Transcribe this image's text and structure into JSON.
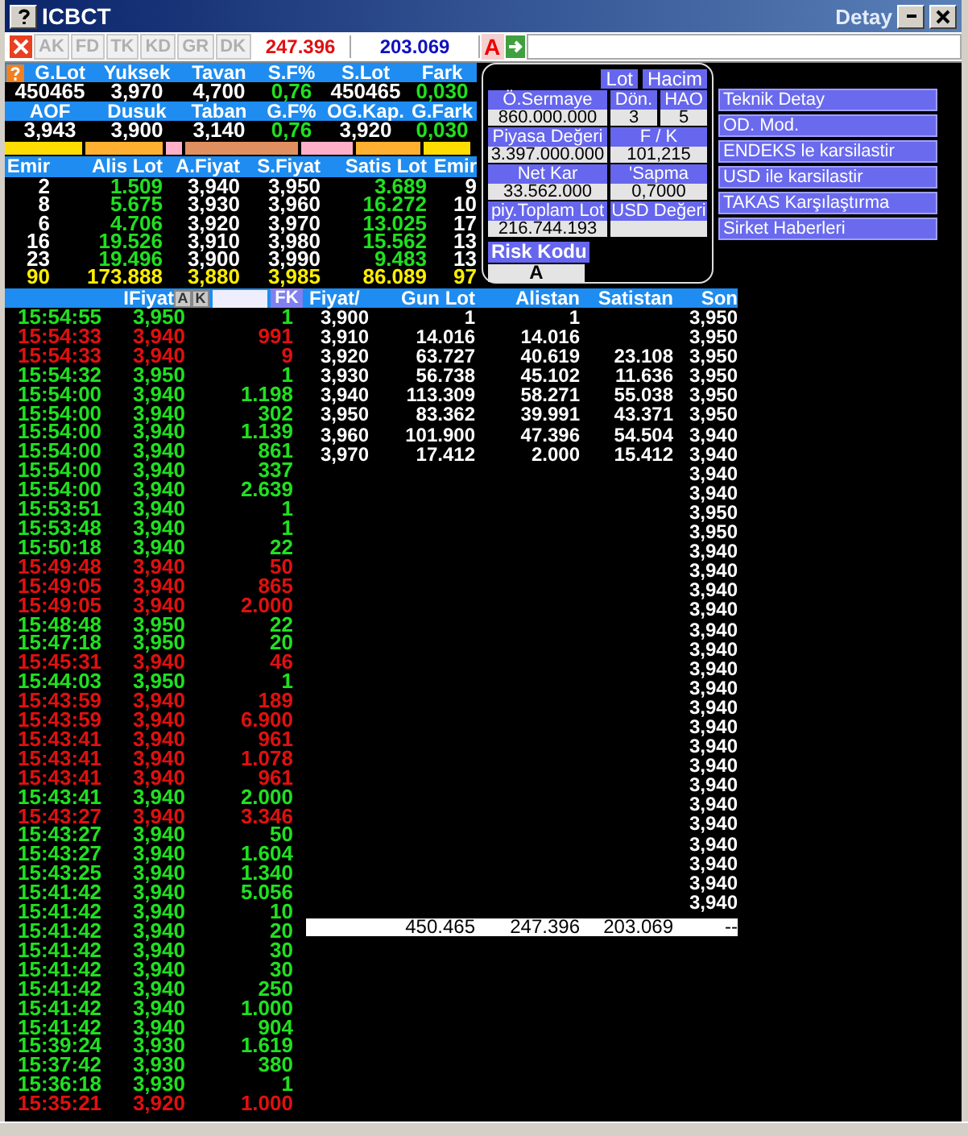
{
  "window": {
    "title": "ICBCT",
    "caption": "Detay"
  },
  "toolbar": {
    "buttons": [
      {
        "label": "AK",
        "disabled": true
      },
      {
        "label": "FD",
        "disabled": true
      },
      {
        "label": "TK",
        "disabled": true
      },
      {
        "label": "KD",
        "disabled": true
      },
      {
        "label": "GR",
        "disabled": true
      },
      {
        "label": "DK",
        "disabled": true
      }
    ],
    "sell_total": "247.396",
    "buy_total": "203.069",
    "mode": "A"
  },
  "stats": [
    {
      "headers": [
        "G.Lot",
        "Yuksek",
        "Tavan",
        "S.F%",
        "S.Lot",
        "Fark"
      ],
      "values": [
        {
          "text": "450465",
          "kind": "plain"
        },
        {
          "text": "3,970",
          "kind": "plain"
        },
        {
          "text": "4,700",
          "kind": "plain"
        },
        {
          "text": "0,76",
          "kind": "change"
        },
        {
          "text": "450465",
          "kind": "plain"
        },
        {
          "text": "0,030",
          "kind": "change"
        }
      ]
    },
    {
      "headers": [
        "AOF",
        "Dusuk",
        "Taban",
        "G.F%",
        "OG.Kap.",
        "G.Fark"
      ],
      "values": [
        {
          "text": "3,943",
          "kind": "plain"
        },
        {
          "text": "3,900",
          "kind": "plain"
        },
        {
          "text": "3,140",
          "kind": "plain"
        },
        {
          "text": "0,76",
          "kind": "change"
        },
        {
          "text": "3,920",
          "kind": "plain"
        },
        {
          "text": "0,030",
          "kind": "change"
        }
      ]
    }
  ],
  "depth": {
    "columns": [
      "Emir",
      "Alis Lot",
      "A.Fiyat",
      "S.Fiyat",
      "Satis Lot",
      "Emir"
    ],
    "rows": [
      {
        "cells": [
          "2",
          "1.509",
          "3,940",
          "3,950",
          "3.689",
          "9"
        ],
        "total": false
      },
      {
        "cells": [
          "8",
          "5.675",
          "3,930",
          "3,960",
          "16.272",
          "10"
        ],
        "total": false
      },
      {
        "cells": [
          "6",
          "4.706",
          "3,920",
          "3,970",
          "13.025",
          "17"
        ],
        "total": false
      },
      {
        "cells": [
          "16",
          "19.526",
          "3,910",
          "3,980",
          "15.562",
          "13"
        ],
        "total": false
      },
      {
        "cells": [
          "23",
          "19.496",
          "3,900",
          "3,990",
          "9.483",
          "13"
        ],
        "total": false
      },
      {
        "cells": [
          "90",
          "173.888",
          "3,880",
          "3,985",
          "86.089",
          "97"
        ],
        "total": true
      }
    ]
  },
  "info": {
    "toggles": [
      "Lot",
      "Hacim"
    ],
    "rows": [
      [
        {
          "label": "Ö.Sermaye",
          "value": "860.000.000"
        },
        {
          "label": "Dön.",
          "value": "3"
        },
        {
          "label": "HAO",
          "value": "5"
        }
      ],
      [
        {
          "label": "Piyasa Değeri",
          "value": "3.397.000.000"
        },
        {
          "label": "F / K",
          "value": "101,215"
        }
      ],
      [
        {
          "label": "Net Kar",
          "value": "33.562.000"
        },
        {
          "label": "'Sapma",
          "value": "0,7000"
        }
      ],
      [
        {
          "label": "piy.Toplam Lot",
          "value": "216.744.193"
        },
        {
          "label": "USD Değeri"
        }
      ]
    ],
    "risk": {
      "label": "Risk Kodu",
      "value": "A"
    }
  },
  "actions": [
    "Teknik Detay",
    "OD. Mod.",
    "ENDEKS le karsilastir",
    "USD ile karsilastir",
    "TAKAS Karşılaştırma",
    "Sirket Haberleri"
  ],
  "trades": {
    "header": "IFiyat",
    "buttons": [
      "A",
      "K"
    ],
    "filter_button": "FK",
    "rows": [
      {
        "time": "15:54:55",
        "price": "3,950",
        "lot": "1",
        "color": "#20e020"
      },
      {
        "time": "15:54:33",
        "price": "3,940",
        "lot": "991",
        "color": "#e01010"
      },
      {
        "time": "15:54:33",
        "price": "3,940",
        "lot": "9",
        "color": "#e01010"
      },
      {
        "time": "15:54:32",
        "price": "3,950",
        "lot": "1",
        "color": "#20e020"
      },
      {
        "time": "15:54:00",
        "price": "3,940",
        "lot": "1.198",
        "color": "#20e020"
      },
      {
        "time": "15:54:00",
        "price": "3,940",
        "lot": "302",
        "color": "#20e020"
      },
      {
        "time": "15:54:00",
        "price": "3,940",
        "lot": "1.139",
        "color": "#20e020"
      },
      {
        "time": "15:54:00",
        "price": "3,940",
        "lot": "861",
        "color": "#20e020"
      },
      {
        "time": "15:54:00",
        "price": "3,940",
        "lot": "337",
        "color": "#20e020"
      },
      {
        "time": "15:54:00",
        "price": "3,940",
        "lot": "2.639",
        "color": "#20e020"
      },
      {
        "time": "15:53:51",
        "price": "3,940",
        "lot": "1",
        "color": "#20e020"
      },
      {
        "time": "15:53:48",
        "price": "3,940",
        "lot": "1",
        "color": "#20e020"
      },
      {
        "time": "15:50:18",
        "price": "3,940",
        "lot": "22",
        "color": "#20e020"
      },
      {
        "time": "15:49:48",
        "price": "3,940",
        "lot": "50",
        "color": "#e01010"
      },
      {
        "time": "15:49:05",
        "price": "3,940",
        "lot": "865",
        "color": "#e01010"
      },
      {
        "time": "15:49:05",
        "price": "3,940",
        "lot": "2.000",
        "color": "#e01010"
      },
      {
        "time": "15:48:48",
        "price": "3,950",
        "lot": "22",
        "color": "#20e020"
      },
      {
        "time": "15:47:18",
        "price": "3,950",
        "lot": "20",
        "color": "#20e020"
      },
      {
        "time": "15:45:31",
        "price": "3,940",
        "lot": "46",
        "color": "#e01010"
      },
      {
        "time": "15:44:03",
        "price": "3,950",
        "lot": "1",
        "color": "#20e020"
      },
      {
        "time": "15:43:59",
        "price": "3,940",
        "lot": "189",
        "color": "#e01010"
      },
      {
        "time": "15:43:59",
        "price": "3,940",
        "lot": "6.900",
        "color": "#e01010"
      },
      {
        "time": "15:43:41",
        "price": "3,940",
        "lot": "961",
        "color": "#e01010"
      },
      {
        "time": "15:43:41",
        "price": "3,940",
        "lot": "1.078",
        "color": "#e01010"
      },
      {
        "time": "15:43:41",
        "price": "3,940",
        "lot": "961",
        "color": "#e01010"
      },
      {
        "time": "15:43:41",
        "price": "3,940",
        "lot": "2.000",
        "color": "#20e020"
      },
      {
        "time": "15:43:27",
        "price": "3,940",
        "lot": "3.346",
        "color": "#e01010"
      },
      {
        "time": "15:43:27",
        "price": "3,940",
        "lot": "50",
        "color": "#20e020"
      },
      {
        "time": "15:43:27",
        "price": "3,940",
        "lot": "1.604",
        "color": "#20e020"
      },
      {
        "time": "15:43:25",
        "price": "3,940",
        "lot": "1.340",
        "color": "#20e020"
      },
      {
        "time": "15:41:42",
        "price": "3,940",
        "lot": "5.056",
        "color": "#20e020"
      },
      {
        "time": "15:41:42",
        "price": "3,940",
        "lot": "10",
        "color": "#20e020"
      },
      {
        "time": "15:41:42",
        "price": "3,940",
        "lot": "20",
        "color": "#20e020"
      },
      {
        "time": "15:41:42",
        "price": "3,940",
        "lot": "30",
        "color": "#20e020"
      },
      {
        "time": "15:41:42",
        "price": "3,940",
        "lot": "30",
        "color": "#20e020"
      },
      {
        "time": "15:41:42",
        "price": "3,940",
        "lot": "250",
        "color": "#20e020"
      },
      {
        "time": "15:41:42",
        "price": "3,940",
        "lot": "1.000",
        "color": "#20e020"
      },
      {
        "time": "15:41:42",
        "price": "3,940",
        "lot": "904",
        "color": "#20e020"
      },
      {
        "time": "15:39:24",
        "price": "3,930",
        "lot": "1.619",
        "color": "#20e020"
      },
      {
        "time": "15:37:42",
        "price": "3,930",
        "lot": "380",
        "color": "#20e020"
      },
      {
        "time": "15:36:18",
        "price": "3,930",
        "lot": "1",
        "color": "#20e020"
      },
      {
        "time": "15:35:21",
        "price": "3,920",
        "lot": "1.000",
        "color": "#e01010"
      }
    ]
  },
  "price_table": {
    "columns": [
      "Fiyat/",
      "Gun Lot",
      "Alistan",
      "Satistan",
      "Son"
    ],
    "rows": [
      {
        "price": "3,900",
        "gun_lot": "1",
        "alistan": "1"
      },
      {
        "price": "3,910",
        "gun_lot": "14.016",
        "alistan": "14.016"
      },
      {
        "price": "3,920",
        "gun_lot": "63.727",
        "alistan": "40.619",
        "satistan": "23.108"
      },
      {
        "price": "3,930",
        "gun_lot": "56.738",
        "alistan": "45.102",
        "satistan": "11.636"
      },
      {
        "price": "3,940",
        "gun_lot": "113.309",
        "alistan": "58.271",
        "satistan": "55.038"
      },
      {
        "price": "3,950",
        "gun_lot": "83.362",
        "alistan": "39.991",
        "satistan": "43.371"
      },
      {
        "price": "3,960",
        "gun_lot": "101.900",
        "alistan": "47.396",
        "satistan": "54.504"
      },
      {
        "price": "3,970",
        "gun_lot": "17.412",
        "alistan": "2.000",
        "satistan": "15.412"
      }
    ],
    "son": [
      "3,950",
      "3,950",
      "3,950",
      "3,950",
      "3,950",
      "3,950",
      "3,940",
      "3,940",
      "3,940",
      "3,940",
      "3,950",
      "3,950",
      "3,940",
      "3,940",
      "3,940",
      "3,940",
      "3,940",
      "3,940",
      "3,940",
      "3,940",
      "3,940",
      "3,940",
      "3,940",
      "3,940",
      "3,940",
      "3,940",
      "3,940",
      "3,940",
      "3,940",
      "3,940",
      "3,940"
    ],
    "totals": {
      "gun_lot": "450.465",
      "alistan": "247.396",
      "satistan": "203.069",
      "son": "--"
    }
  }
}
